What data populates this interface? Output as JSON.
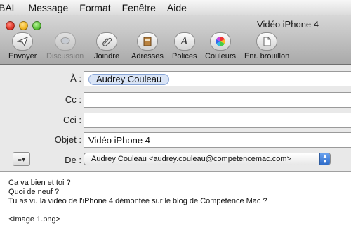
{
  "menubar": {
    "items": [
      "BAL",
      "Message",
      "Format",
      "Fenêtre",
      "Aide"
    ]
  },
  "window": {
    "title": "Vidéo iPhone 4"
  },
  "toolbar": {
    "buttons": [
      {
        "label": "Envoyer",
        "icon": "paper-plane-icon"
      },
      {
        "label": "Discussion",
        "icon": "chat-bubble-icon",
        "disabled": true
      },
      {
        "label": "Joindre",
        "icon": "paperclip-icon"
      },
      {
        "label": "Adresses",
        "icon": "address-book-icon"
      },
      {
        "label": "Polices",
        "icon": "font-icon"
      },
      {
        "label": "Couleurs",
        "icon": "color-wheel-icon"
      },
      {
        "label": "Enr. brouillon",
        "icon": "draft-document-icon"
      }
    ]
  },
  "fields": {
    "to": {
      "label": "À :",
      "recipient": "Audrey Couleau"
    },
    "cc": {
      "label": "Cc :",
      "value": ""
    },
    "bcc": {
      "label": "Cci :",
      "value": ""
    },
    "subject": {
      "label": "Objet :",
      "value": "Vidéo iPhone 4"
    },
    "from": {
      "label": "De :",
      "value": "Audrey Couleau <audrey.couleau@competencemac.com>"
    }
  },
  "body": {
    "lines": [
      "Ca va bien et toi ?",
      "Quoi de neuf ?",
      "Tu as vu la vidéo de l'iPhone 4 démontée sur le blog de Compétence Mac ?",
      "",
      "<Image 1.png>"
    ]
  }
}
